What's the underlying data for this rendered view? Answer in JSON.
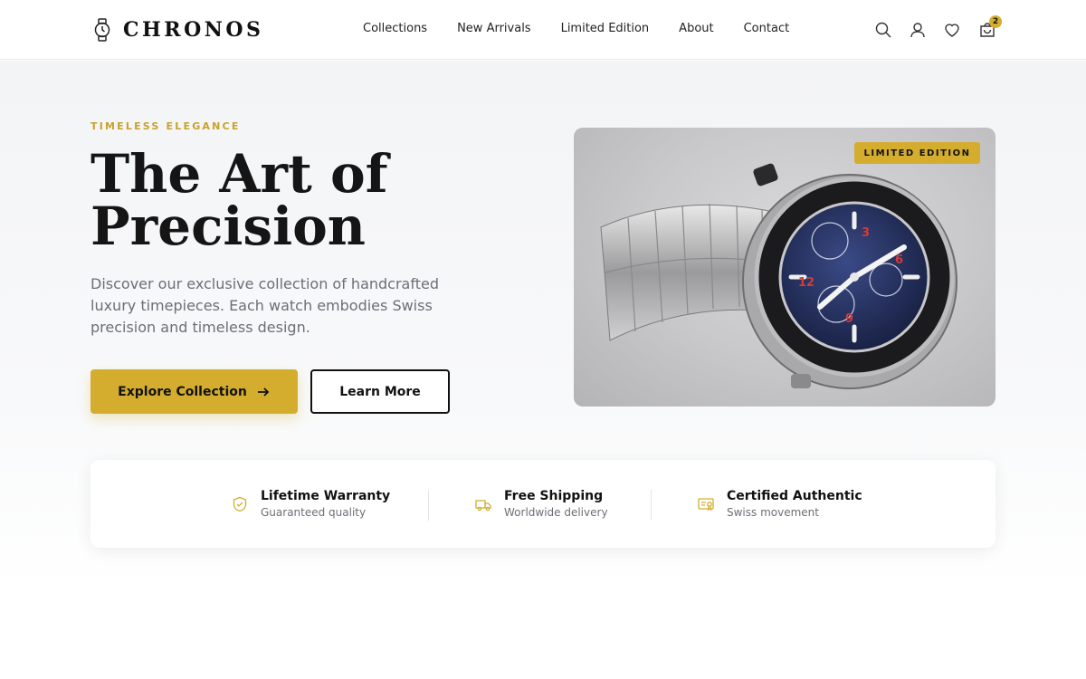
{
  "brand": {
    "name": "CHRONOS",
    "icon": "watch-icon"
  },
  "nav": {
    "items": [
      "Collections",
      "New Arrivals",
      "Limited Edition",
      "About",
      "Contact"
    ]
  },
  "header_icons": {
    "search": "search-icon",
    "account": "user-icon",
    "wishlist": "heart-icon",
    "cart": "shopping-bag-icon",
    "cart_count": "2"
  },
  "hero": {
    "eyebrow": "TIMELESS ELEGANCE",
    "title_line1": "The Art of",
    "title_line2": "Precision",
    "description": "Discover our exclusive collection of handcrafted luxury timepieces. Each watch embodies Swiss precision and timeless design.",
    "primary_button": "Explore Collection",
    "secondary_button": "Learn More",
    "badge": "LIMITED EDITION"
  },
  "features": [
    {
      "title": "Lifetime Warranty",
      "subtitle": "Guaranteed quality",
      "icon": "shield-check-icon"
    },
    {
      "title": "Free Shipping",
      "subtitle": "Worldwide delivery",
      "icon": "truck-icon"
    },
    {
      "title": "Certified Authentic",
      "subtitle": "Swiss movement",
      "icon": "certificate-icon"
    }
  ],
  "colors": {
    "accent": "#d4ad2f",
    "text": "#111111",
    "muted": "#6b6f76",
    "background": "#f3f4f6"
  }
}
